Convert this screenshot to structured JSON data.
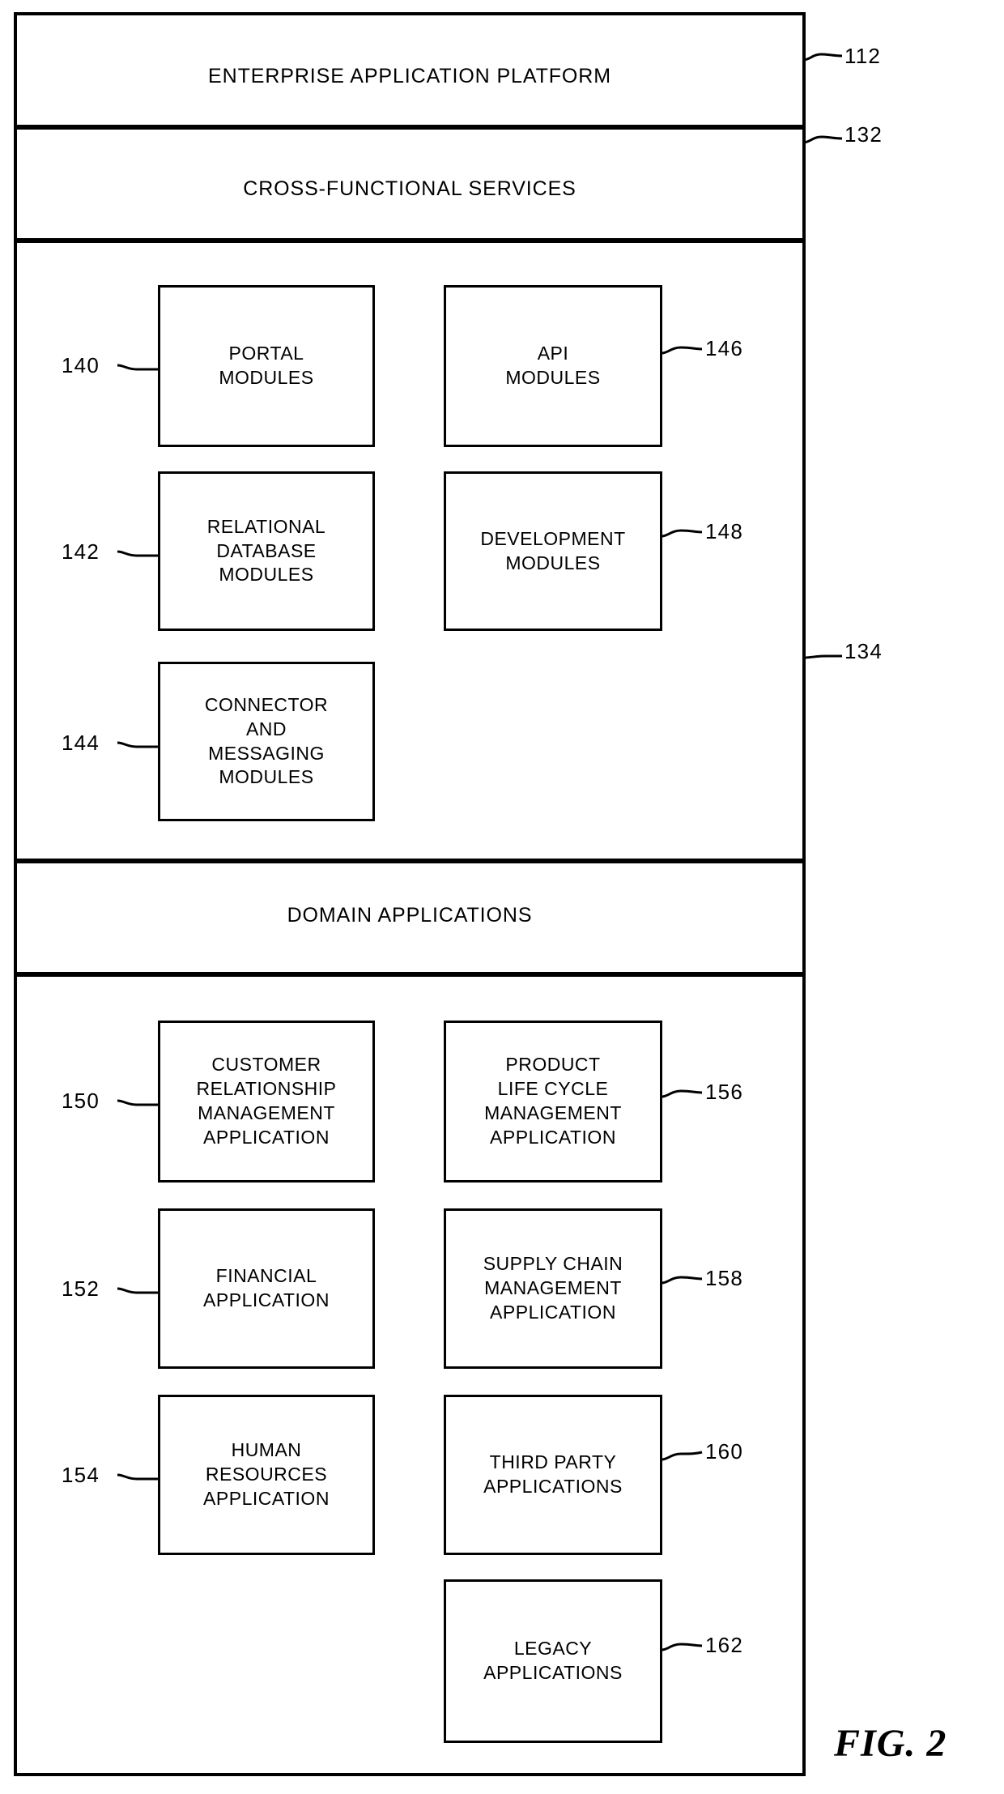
{
  "figure": {
    "caption": "FIG. 2"
  },
  "bands": [
    {
      "id": "112",
      "label": "ENTERPRISE APPLICATION PLATFORM",
      "ref": "112"
    },
    {
      "id": "132",
      "label": "CROSS-FUNCTIONAL SERVICES",
      "ref": "132"
    },
    {
      "id": "134",
      "label": "DOMAIN APPLICATIONS",
      "ref": "134"
    }
  ],
  "cross_functional_services": {
    "left_column": [
      {
        "ref": "140",
        "ref_side": "left",
        "lines": [
          "PORTAL",
          "MODULES"
        ]
      },
      {
        "ref": "142",
        "ref_side": "left",
        "lines": [
          "RELATIONAL",
          "DATABASE",
          "MODULES"
        ]
      },
      {
        "ref": "144",
        "ref_side": "left",
        "lines": [
          "CONNECTOR",
          "AND",
          "MESSAGING",
          "MODULES"
        ]
      }
    ],
    "right_column": [
      {
        "ref": "146",
        "ref_side": "right",
        "lines": [
          "API",
          "MODULES"
        ]
      },
      {
        "ref": "148",
        "ref_side": "right",
        "lines": [
          "DEVELOPMENT",
          "MODULES"
        ]
      }
    ]
  },
  "domain_applications": {
    "left_column": [
      {
        "ref": "150",
        "ref_side": "left",
        "lines": [
          "CUSTOMER",
          "RELATIONSHIP",
          "MANAGEMENT",
          "APPLICATION"
        ]
      },
      {
        "ref": "152",
        "ref_side": "left",
        "lines": [
          "FINANCIAL",
          "APPLICATION"
        ]
      },
      {
        "ref": "154",
        "ref_side": "left",
        "lines": [
          "HUMAN",
          "RESOURCES",
          "APPLICATION"
        ]
      }
    ],
    "right_column": [
      {
        "ref": "156",
        "ref_side": "right",
        "lines": [
          "PRODUCT",
          "LIFE CYCLE",
          "MANAGEMENT",
          "APPLICATION"
        ]
      },
      {
        "ref": "158",
        "ref_side": "right",
        "lines": [
          "SUPPLY CHAIN",
          "MANAGEMENT",
          "APPLICATION"
        ]
      },
      {
        "ref": "160",
        "ref_side": "right",
        "lines": [
          "THIRD PARTY",
          "APPLICATIONS"
        ]
      },
      {
        "ref": "162",
        "ref_side": "right",
        "lines": [
          "LEGACY",
          "APPLICATIONS"
        ]
      }
    ]
  },
  "colors": {
    "ink": "#000000",
    "paper": "#ffffff"
  }
}
